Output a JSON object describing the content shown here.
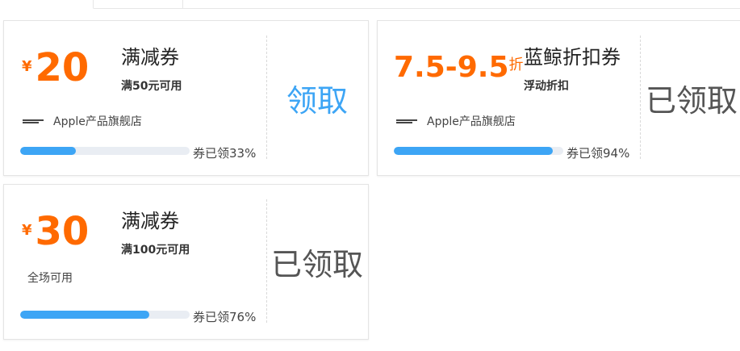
{
  "tabs": [],
  "colors": {
    "accent_orange": "#ff6a00",
    "accent_blue": "#3da5f5",
    "progress_track": "#e9edf3"
  },
  "coupons": [
    {
      "currency": "¥",
      "amount": "20",
      "title": "满减券",
      "condition": "满50元可用",
      "store_logo_icon": "apple-authorized-reseller-logo",
      "store_name": "Apple产品旗舰店",
      "progress_percent": 33,
      "progress_text": "券已领33%",
      "action_label": "领取",
      "claimed": false
    },
    {
      "amount": "7.5-9.5",
      "amount_unit": "折",
      "title": "蓝鲸折扣券",
      "condition": "浮动折扣",
      "store_logo_icon": "apple-authorized-reseller-logo",
      "store_name": "Apple产品旗舰店",
      "progress_percent": 94,
      "progress_text": "券已领94%",
      "action_label": "已领取",
      "claimed": true
    },
    {
      "currency": "¥",
      "amount": "30",
      "title": "满减券",
      "condition": "满100元可用",
      "scope": "全场可用",
      "progress_percent": 76,
      "progress_text": "券已领76%",
      "action_label": "已领取",
      "claimed": true
    }
  ]
}
